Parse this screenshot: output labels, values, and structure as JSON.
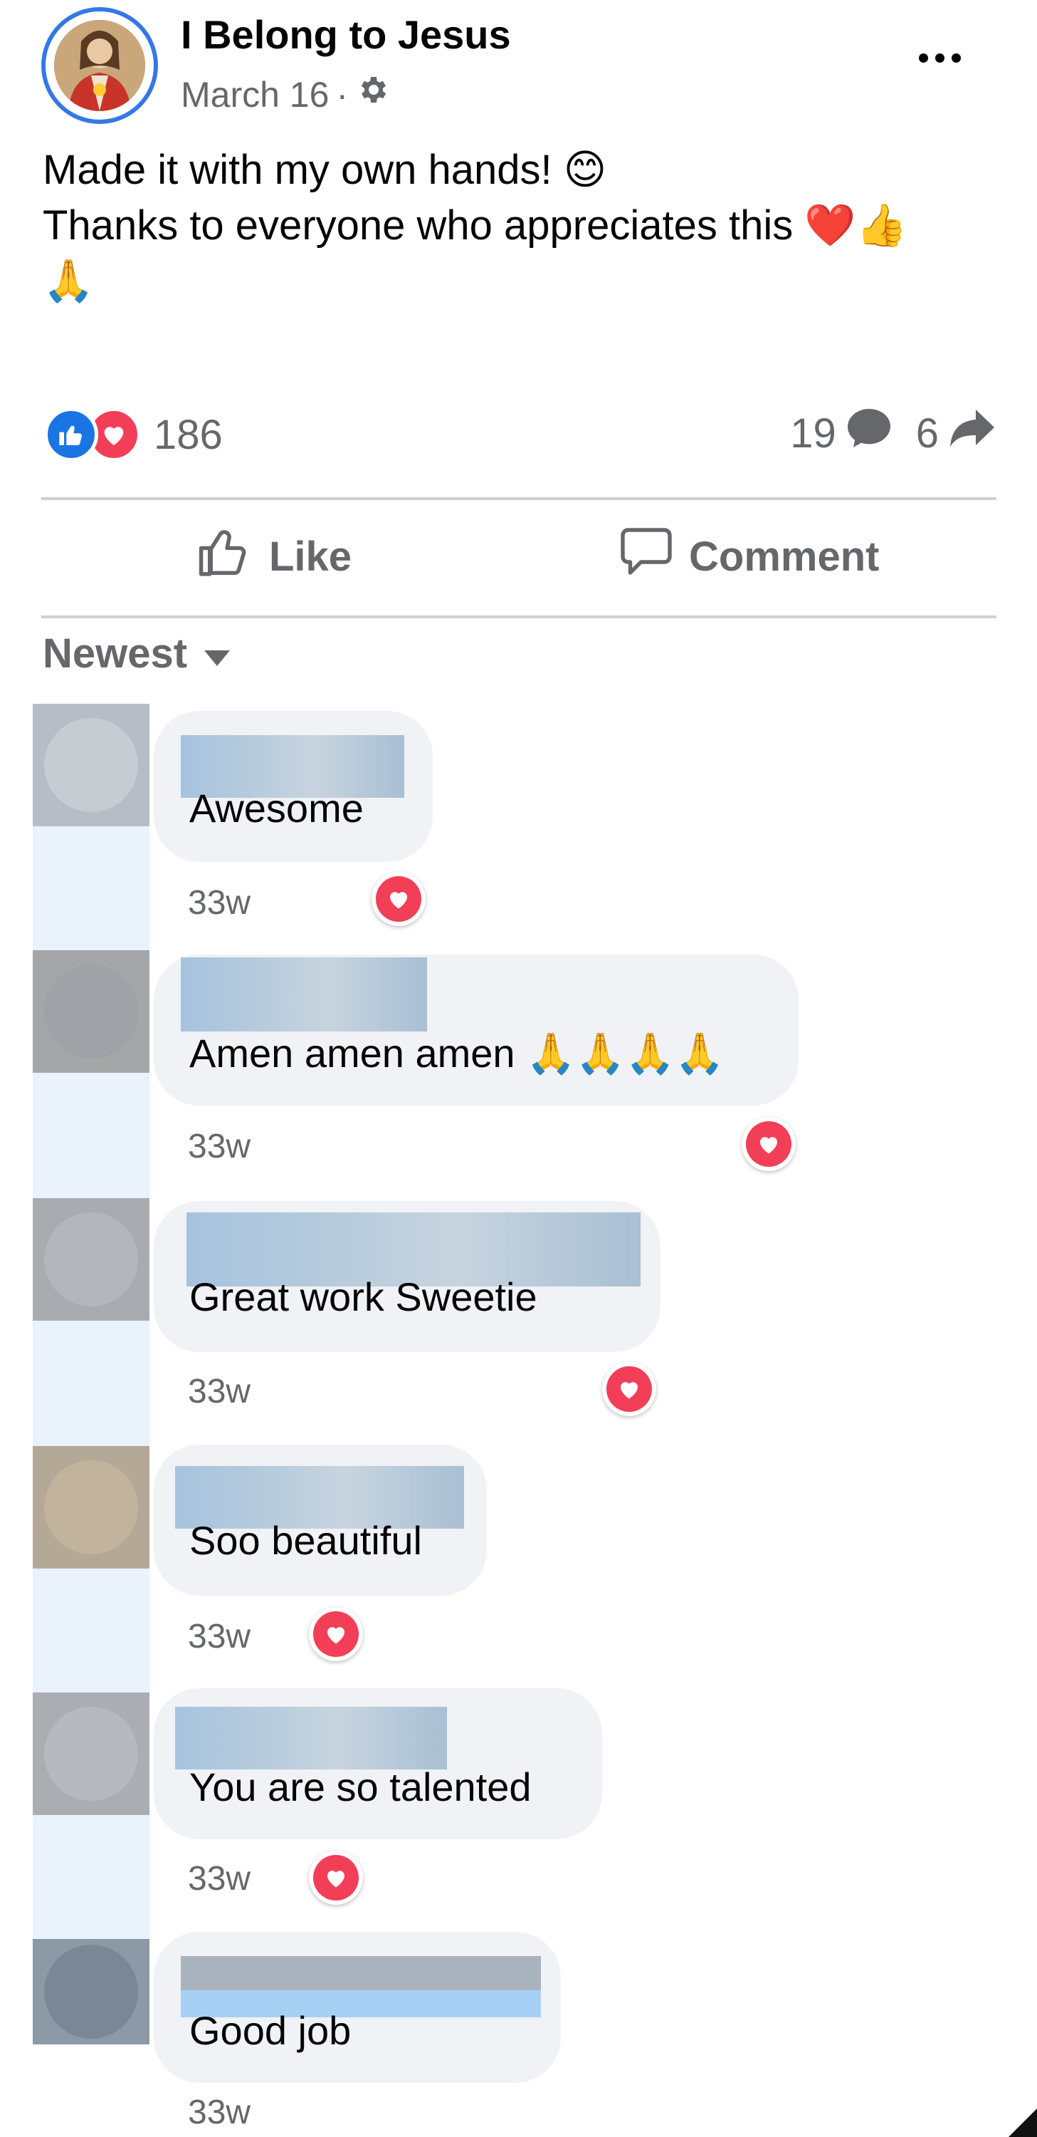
{
  "post": {
    "page_name": "I Belong to Jesus",
    "date": "March 16",
    "separator": "·",
    "privacy_icon": "gear-icon",
    "more_icon": "more-options-icon",
    "text_lines": [
      "Made it with my own hands! 😊",
      "Thanks to everyone who appreciates this ❤️👍",
      "🙏"
    ]
  },
  "stats": {
    "reaction_icons": [
      "like-icon",
      "love-icon"
    ],
    "reaction_count": "186",
    "comment_count": "19",
    "share_count": "6"
  },
  "actions": {
    "like_label": "Like",
    "comment_label": "Comment"
  },
  "sort": {
    "label": "Newest"
  },
  "comments": [
    {
      "text": "Awesome",
      "time": "33w",
      "reaction": "love"
    },
    {
      "text": "Amen amen amen 🙏🙏🙏🙏",
      "time": "33w",
      "reaction": "love"
    },
    {
      "text": "Great work Sweetie",
      "time": "33w",
      "reaction": "love"
    },
    {
      "text": "Soo beautiful",
      "time": "33w",
      "reaction": "love"
    },
    {
      "text": "You are so talented",
      "time": "33w",
      "reaction": "love"
    },
    {
      "text": "Good job",
      "time": "33w",
      "reaction": ""
    }
  ],
  "colors": {
    "accent": "#1b74e4",
    "love": "#f33e58",
    "secondary_text": "#65676b",
    "bubble": "#f0f2f5"
  }
}
